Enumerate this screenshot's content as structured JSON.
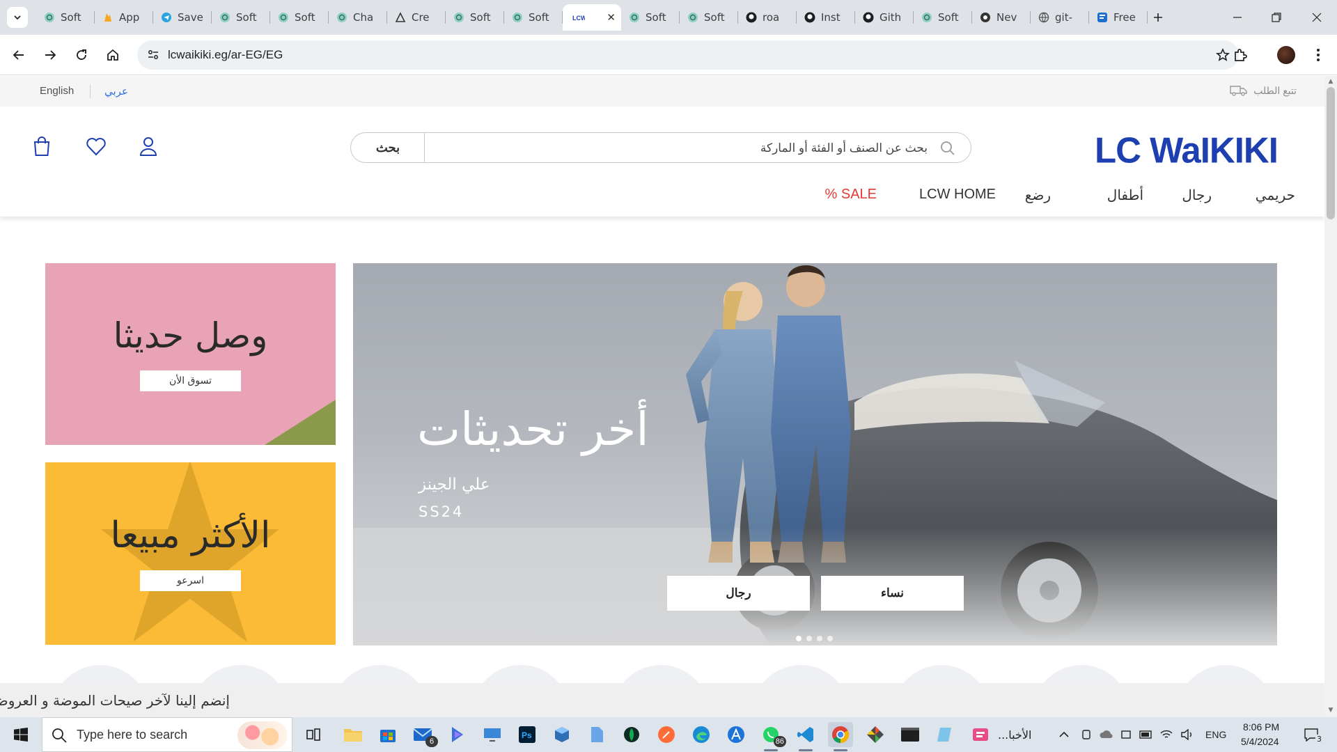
{
  "browser": {
    "tabs": [
      {
        "title": "Soft",
        "icon": "chatgpt-icon"
      },
      {
        "title": "App",
        "icon": "firebase-icon"
      },
      {
        "title": "Save",
        "icon": "telegram-icon"
      },
      {
        "title": "Soft",
        "icon": "chatgpt-icon"
      },
      {
        "title": "Soft",
        "icon": "chatgpt-icon"
      },
      {
        "title": "Cha",
        "icon": "chatgpt-icon"
      },
      {
        "title": "Cre",
        "icon": "cre-icon"
      },
      {
        "title": "Soft",
        "icon": "chatgpt-icon"
      },
      {
        "title": "Soft",
        "icon": "chatgpt-icon"
      },
      {
        "title": "LCW",
        "icon": "lcw-icon",
        "active": true
      },
      {
        "title": "Soft",
        "icon": "chatgpt-icon"
      },
      {
        "title": "Soft",
        "icon": "chatgpt-icon"
      },
      {
        "title": "roa",
        "icon": "github-icon"
      },
      {
        "title": "Inst",
        "icon": "github-icon"
      },
      {
        "title": "Gith",
        "icon": "github-icon"
      },
      {
        "title": "Soft",
        "icon": "chatgpt-icon"
      },
      {
        "title": "Nev",
        "icon": "nev-icon"
      },
      {
        "title": "git-",
        "icon": "globe-icon"
      },
      {
        "title": "Free",
        "icon": "free-icon"
      }
    ],
    "url": "lcwaikiki.eg/ar-EG/EG"
  },
  "site": {
    "lang_en": "English",
    "lang_ar": "عربي",
    "track_order": "تتبع الطلب",
    "logo": "LC WaIKIKI",
    "search_button": "بحث",
    "search_placeholder": "بحث عن الصنف أو الفئة أو الماركة",
    "nav": [
      "حريمي",
      "رجال",
      "أطفال",
      "رضع",
      "LCW HOME",
      "% SALE"
    ],
    "promo1": {
      "title": "وصل حديثا",
      "button": "تسوق الأن"
    },
    "promo2": {
      "title": "الأكثر مبيعا",
      "button": "اسرعو"
    },
    "hero": {
      "title": "أخر تحديثات",
      "subtitle": "علي الجينز",
      "season": "SS24",
      "btn_women": "نساء",
      "btn_men": "رجال",
      "slides": 4,
      "active_slide": 1
    },
    "newsletter": "إنضم إلينا لآخر صيحات الموضة و العروض"
  },
  "taskbar": {
    "search_placeholder": "Type here to search",
    "mail_badge": "6",
    "whatsapp_badge": "86",
    "running_label": "الأخبا...",
    "lang": "ENG",
    "time": "8:06 PM",
    "date": "5/4/2024",
    "notif_count": "3"
  },
  "colors": {
    "brand": "#1e3fb0",
    "sale": "#e53935",
    "promo_pink": "#e9a3b6",
    "promo_yellow": "#fbbb36"
  }
}
